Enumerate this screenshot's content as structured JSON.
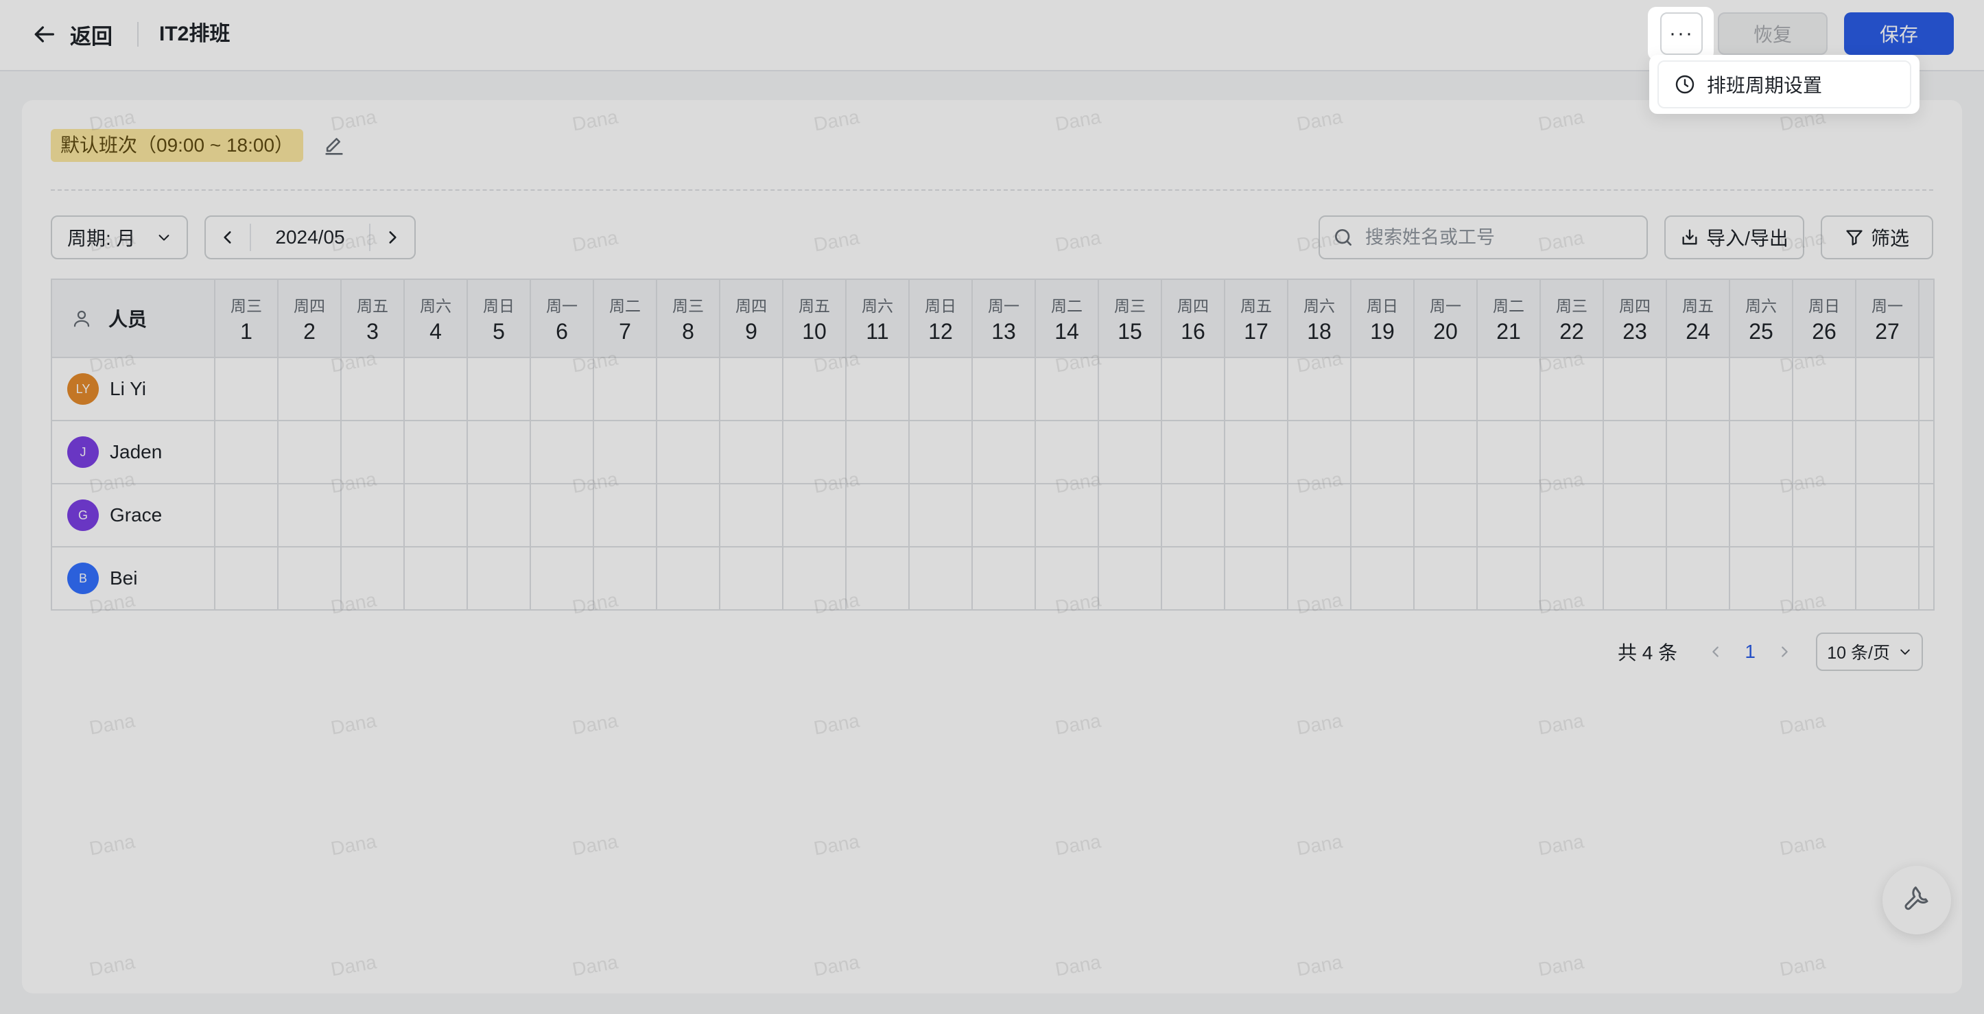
{
  "header": {
    "back_label": "返回",
    "title": "IT2排班",
    "more_label": "···",
    "restore_label": "恢复",
    "save_label": "保存"
  },
  "dropdown": {
    "items": [
      {
        "icon": "clock-icon",
        "label": "排班周期设置"
      }
    ]
  },
  "shift": {
    "tag_label": "默认班次（09:00 ~ 18:00）"
  },
  "toolbar": {
    "period_label": "周期: 月",
    "month": "2024/05",
    "search_placeholder": "搜索姓名或工号",
    "import_export_label": "导入/导出",
    "filter_label": "筛选"
  },
  "table": {
    "person_header": "人员",
    "days": [
      {
        "week": "周三",
        "num": "1"
      },
      {
        "week": "周四",
        "num": "2"
      },
      {
        "week": "周五",
        "num": "3"
      },
      {
        "week": "周六",
        "num": "4"
      },
      {
        "week": "周日",
        "num": "5"
      },
      {
        "week": "周一",
        "num": "6"
      },
      {
        "week": "周二",
        "num": "7"
      },
      {
        "week": "周三",
        "num": "8"
      },
      {
        "week": "周四",
        "num": "9"
      },
      {
        "week": "周五",
        "num": "10"
      },
      {
        "week": "周六",
        "num": "11"
      },
      {
        "week": "周日",
        "num": "12"
      },
      {
        "week": "周一",
        "num": "13"
      },
      {
        "week": "周二",
        "num": "14"
      },
      {
        "week": "周三",
        "num": "15"
      },
      {
        "week": "周四",
        "num": "16"
      },
      {
        "week": "周五",
        "num": "17"
      },
      {
        "week": "周六",
        "num": "18"
      },
      {
        "week": "周日",
        "num": "19"
      },
      {
        "week": "周一",
        "num": "20"
      },
      {
        "week": "周二",
        "num": "21"
      },
      {
        "week": "周三",
        "num": "22"
      },
      {
        "week": "周四",
        "num": "23"
      },
      {
        "week": "周五",
        "num": "24"
      },
      {
        "week": "周六",
        "num": "25"
      },
      {
        "week": "周日",
        "num": "26"
      },
      {
        "week": "周一",
        "num": "27"
      }
    ],
    "rows": [
      {
        "initials": "LY",
        "name": "Li Yi",
        "color": "#e38a2c"
      },
      {
        "initials": "J",
        "name": "Jaden",
        "color": "#7b3fe4"
      },
      {
        "initials": "G",
        "name": "Grace",
        "color": "#7b3fe4"
      },
      {
        "initials": "B",
        "name": "Bei",
        "color": "#3370ff"
      }
    ]
  },
  "pagination": {
    "total_label": "共 4 条",
    "current_page": "1",
    "page_size_label": "10 条/页"
  },
  "watermark_text": "Dana",
  "colors": {
    "primary": "#2b5ce6",
    "shift_tag_bg": "#fbe7a1"
  }
}
